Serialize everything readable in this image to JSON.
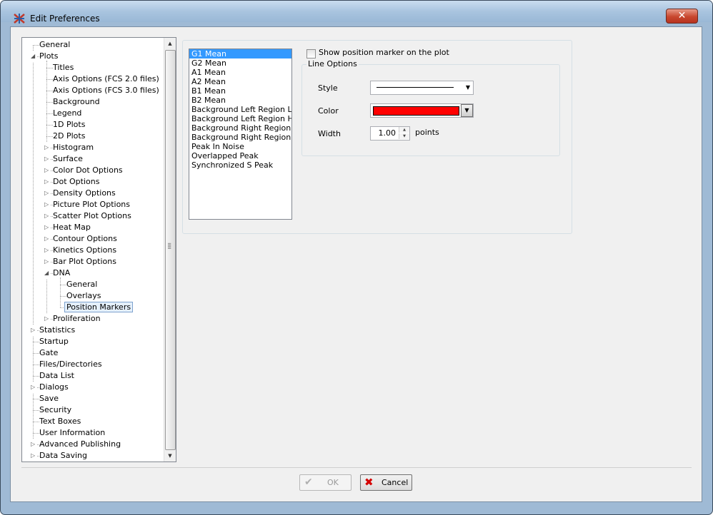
{
  "window": {
    "title": "Edit Preferences",
    "close_glyph": "✕"
  },
  "tree": {
    "items": [
      {
        "label": "General"
      },
      {
        "label": "Plots"
      },
      {
        "label": "Titles"
      },
      {
        "label": "Axis Options (FCS 2.0 files)"
      },
      {
        "label": "Axis Options (FCS 3.0 files)"
      },
      {
        "label": "Background"
      },
      {
        "label": "Legend"
      },
      {
        "label": "1D Plots"
      },
      {
        "label": "2D Plots"
      },
      {
        "label": "Histogram"
      },
      {
        "label": "Surface"
      },
      {
        "label": "Color Dot Options"
      },
      {
        "label": "Dot Options"
      },
      {
        "label": "Density Options"
      },
      {
        "label": "Picture Plot Options"
      },
      {
        "label": "Scatter Plot Options"
      },
      {
        "label": "Heat Map"
      },
      {
        "label": "Contour Options"
      },
      {
        "label": "Kinetics Options"
      },
      {
        "label": "Bar Plot Options"
      },
      {
        "label": "DNA"
      },
      {
        "label": "General"
      },
      {
        "label": "Overlays"
      },
      {
        "label": "Position Markers"
      },
      {
        "label": "Proliferation"
      },
      {
        "label": "Statistics"
      },
      {
        "label": "Startup"
      },
      {
        "label": "Gate"
      },
      {
        "label": "Files/Directories"
      },
      {
        "label": "Data List"
      },
      {
        "label": "Dialogs"
      },
      {
        "label": "Save"
      },
      {
        "label": "Security"
      },
      {
        "label": "Text Boxes"
      },
      {
        "label": "User Information"
      },
      {
        "label": "Advanced Publishing"
      },
      {
        "label": "Data Saving"
      }
    ],
    "selected": "Position Markers"
  },
  "marker_list": {
    "items": [
      "G1 Mean",
      "G2 Mean",
      "A1 Mean",
      "A2 Mean",
      "B1 Mean",
      "B2 Mean",
      "Background Left Region Low",
      "Background Left Region High",
      "Background Right Region Low",
      "Background Right Region High",
      "Peak In Noise",
      "Overlapped Peak",
      "Synchronized S Peak"
    ],
    "selected": "G1 Mean"
  },
  "show_marker": {
    "label": "Show position marker on the plot",
    "checked": false
  },
  "line_options": {
    "title": "Line Options",
    "style_label": "Style",
    "color_label": "Color",
    "color_value": "#ff0000",
    "width_label": "Width",
    "width_value": "1.00",
    "width_units": "points"
  },
  "buttons": {
    "ok": "OK",
    "cancel": "Cancel"
  }
}
